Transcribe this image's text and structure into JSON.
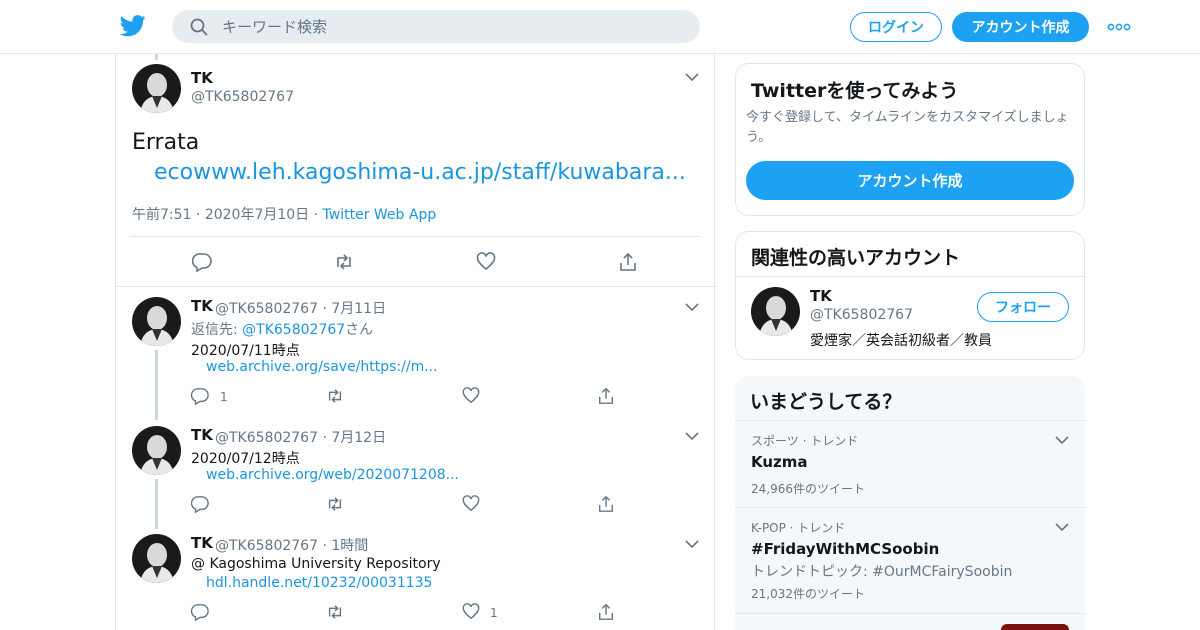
{
  "header": {
    "search_placeholder": "キーワード検索",
    "login_label": "ログイン",
    "signup_label": "アカウント作成"
  },
  "main_tweet": {
    "name": "TK",
    "handle": "@TK65802767",
    "text": "Errata",
    "link": "ecowww.leh.kagoshima-u.ac.jp/staff/kuwabara...",
    "time": "午前7:51",
    "date": "2020年7月10日",
    "source": "Twitter Web App"
  },
  "replies": [
    {
      "name": "TK",
      "handle": "@TK65802767",
      "date": "7月11日",
      "reply_prefix": "返信先: ",
      "reply_to": "@TK65802767",
      "reply_suffix": "さん",
      "text": "2020/07/11時点",
      "link": "web.archive.org/save/https://m...",
      "reply_count": "1",
      "like_count": ""
    },
    {
      "name": "TK",
      "handle": "@TK65802767",
      "date": "7月12日",
      "text": "2020/07/12時点",
      "link": "web.archive.org/web/2020071208...",
      "reply_count": "",
      "like_count": ""
    },
    {
      "name": "TK",
      "handle": "@TK65802767",
      "date": "1時間",
      "text": "@ Kagoshima University Repository",
      "link": "hdl.handle.net/10232/00031135",
      "reply_count": "",
      "like_count": "1"
    }
  ],
  "signup_card": {
    "title": "Twitterを使ってみよう",
    "subtitle_line1": "今すぐ登録して、タイムラインをカスタマイズしましょ",
    "subtitle_line2": "う。",
    "button": "アカウント作成"
  },
  "related_card": {
    "title": "関連性の高いアカウント",
    "name": "TK",
    "handle": "@TK65802767",
    "bio": "愛煙家／英会話初級者／教員",
    "follow_label": "フォロー"
  },
  "trends": {
    "title": "いまどうしてる？",
    "items": [
      {
        "category": "スポーツ · トレンド",
        "name": "Kuzma",
        "desc": "",
        "count": "24,966件のツイート"
      },
      {
        "category": "K-POP · トレンド",
        "name": "#FridayWithMCSoobin",
        "desc": "トレンドトピック: #OurMCFairySoobin",
        "count": "21,032件のツイート"
      }
    ]
  },
  "colors": {
    "accent": "#1da1f2",
    "link": "#1b95e0",
    "muted": "#657786"
  }
}
